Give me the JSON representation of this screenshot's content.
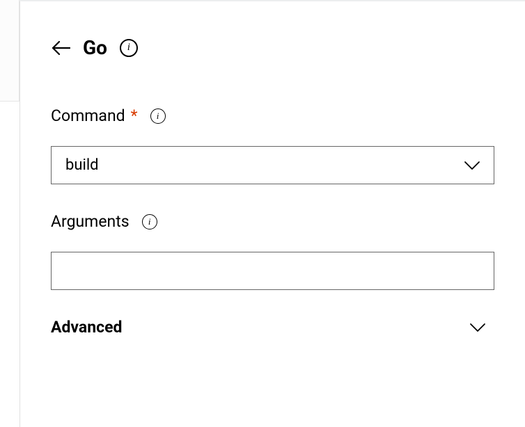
{
  "header": {
    "title": "Go"
  },
  "fields": {
    "command": {
      "label": "Command",
      "required_marker": "*",
      "value": "build"
    },
    "arguments": {
      "label": "Arguments",
      "value": ""
    }
  },
  "advanced": {
    "label": "Advanced"
  }
}
